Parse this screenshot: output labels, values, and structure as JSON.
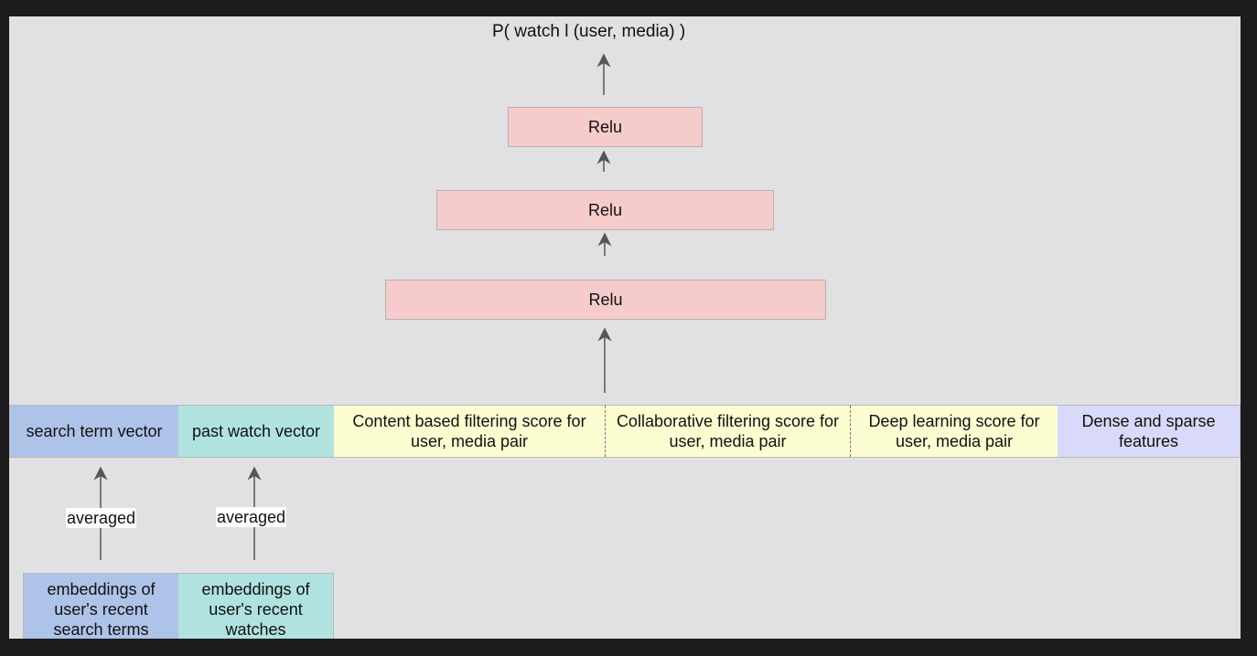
{
  "diagram": {
    "output_label": "P( watch l (user, media) )",
    "relu_layers": [
      {
        "label": "Relu"
      },
      {
        "label": "Relu"
      },
      {
        "label": "Relu"
      }
    ],
    "feature_vector": [
      {
        "label": "search term vector",
        "color": "#aec3e8"
      },
      {
        "label": "past watch vector",
        "color": "#b0e3df"
      },
      {
        "label": "Content based filtering score for user, media pair",
        "color": "#fdfdd2"
      },
      {
        "label": "Collaborative filtering score for user, media pair",
        "color": "#fdfdd2"
      },
      {
        "label": "Deep learning score for user, media pair",
        "color": "#fdfdd2"
      },
      {
        "label": "Dense and sparse features",
        "color": "#d9d9fa"
      }
    ],
    "edge_labels": {
      "search_avg": "averaged",
      "watch_avg": "averaged"
    },
    "inputs": [
      {
        "label": "embeddings of user's recent search terms",
        "color": "#aec3e8"
      },
      {
        "label": "embeddings of user's recent watches",
        "color": "#b0e3df"
      }
    ],
    "colors": {
      "relu_fill": "#f6cbcb",
      "background": "#e1e1e3",
      "arrow": "#555555"
    }
  }
}
